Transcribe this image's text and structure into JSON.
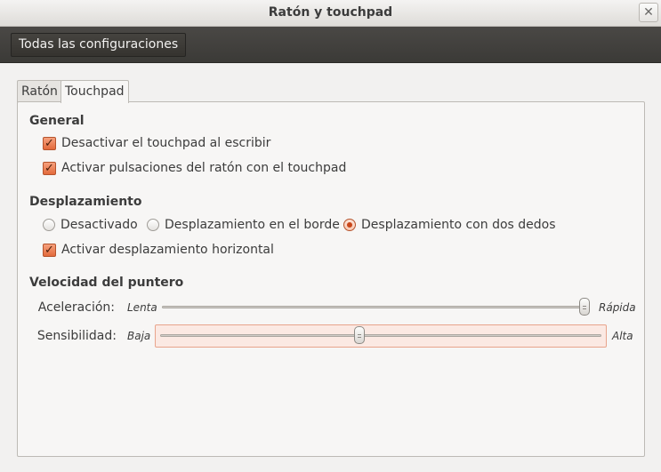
{
  "window": {
    "title": "Ratón y touchpad",
    "close_glyph": "✕"
  },
  "toolbar": {
    "all_settings_label": "Todas las configuraciones"
  },
  "tabs": [
    {
      "label": "Ratón",
      "active": false
    },
    {
      "label": "Touchpad",
      "active": true
    }
  ],
  "general": {
    "heading": "General",
    "options": [
      {
        "label": "Desactivar el touchpad al escribir",
        "checked": true
      },
      {
        "label": "Activar pulsaciones del ratón con el touchpad",
        "checked": true
      }
    ]
  },
  "scrolling": {
    "heading": "Desplazamiento",
    "modes": [
      {
        "label": "Desactivado",
        "selected": false
      },
      {
        "label": "Desplazamiento en el borde",
        "selected": false
      },
      {
        "label": "Desplazamiento con dos dedos",
        "selected": true
      }
    ],
    "horizontal": {
      "label": "Activar desplazamiento horizontal",
      "checked": true
    }
  },
  "pointer_speed": {
    "heading": "Velocidad del puntero",
    "acceleration": {
      "label": "Aceleración:",
      "min_label": "Lenta",
      "max_label": "Rápida",
      "value": 1.0
    },
    "sensitivity": {
      "label": "Sensibilidad:",
      "min_label": "Baja",
      "max_label": "Alta",
      "value": 0.45
    }
  },
  "colors": {
    "accent": "#e36a3b",
    "toolbar_bg": "#3b3a37",
    "window_bg": "#f2f1f0"
  },
  "icons": {
    "check": "checkmark-icon",
    "close": "close-icon"
  }
}
